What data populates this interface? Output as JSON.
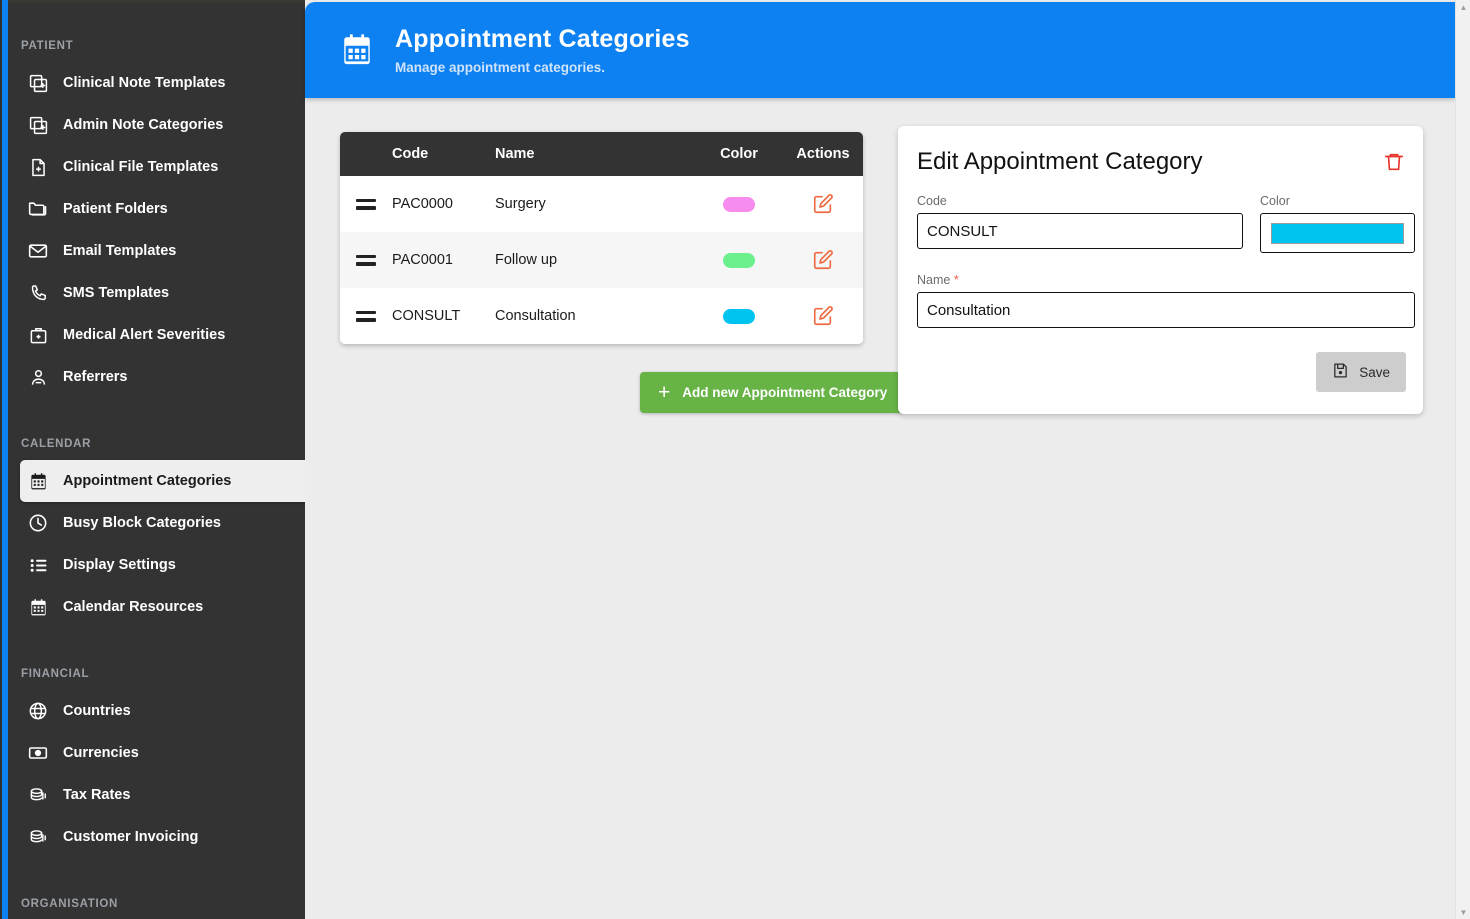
{
  "sidebar": {
    "groups": [
      {
        "label": "PATIENT",
        "items": [
          {
            "label": "Clinical Note Templates",
            "icon": "note-add-icon"
          },
          {
            "label": "Admin Note Categories",
            "icon": "note-add-icon"
          },
          {
            "label": "Clinical File Templates",
            "icon": "file-add-icon"
          },
          {
            "label": "Patient Folders",
            "icon": "folder-icon"
          },
          {
            "label": "Email Templates",
            "icon": "envelope-icon"
          },
          {
            "label": "SMS Templates",
            "icon": "phone-icon"
          },
          {
            "label": "Medical Alert Severities",
            "icon": "medical-kit-icon"
          },
          {
            "label": "Referrers",
            "icon": "person-icon"
          }
        ]
      },
      {
        "label": "CALENDAR",
        "items": [
          {
            "label": "Appointment Categories",
            "icon": "calendar-icon",
            "active": true
          },
          {
            "label": "Busy Block Categories",
            "icon": "clock-icon"
          },
          {
            "label": "Display Settings",
            "icon": "list-icon"
          },
          {
            "label": "Calendar Resources",
            "icon": "calendar-icon"
          }
        ]
      },
      {
        "label": "FINANCIAL",
        "items": [
          {
            "label": "Countries",
            "icon": "globe-icon"
          },
          {
            "label": "Currencies",
            "icon": "banknote-icon"
          },
          {
            "label": "Tax Rates",
            "icon": "coins-icon"
          },
          {
            "label": "Customer Invoicing",
            "icon": "coins-icon"
          }
        ]
      },
      {
        "label": "ORGANISATION",
        "items": []
      }
    ]
  },
  "header": {
    "icon": "calendar-icon",
    "title": "Appointment Categories",
    "subtitle": "Manage appointment categories.",
    "accent_color": "#0d80f2"
  },
  "table": {
    "columns": [
      "",
      "Code",
      "Name",
      "Color",
      "Actions"
    ],
    "rows": [
      {
        "handle": "drag-handle-icon",
        "code": "PAC0000",
        "name": "Surgery",
        "color": "#f78cee",
        "action": "edit-icon"
      },
      {
        "handle": "drag-handle-icon",
        "code": "PAC0001",
        "name": "Follow up",
        "color": "#6cf08d",
        "action": "edit-icon"
      },
      {
        "handle": "drag-handle-icon",
        "code": "CONSULT",
        "name": "Consultation",
        "color": "#00c4f0",
        "action": "edit-icon"
      }
    ]
  },
  "add_button": {
    "label": "Add new Appointment Category",
    "icon": "plus-icon",
    "color": "#67b346"
  },
  "edit_panel": {
    "title": "Edit Appointment Category",
    "delete_icon": "trash-icon",
    "code": {
      "label": "Code",
      "value": "CONSULT",
      "placeholder": ""
    },
    "color": {
      "label": "Color",
      "value": "#00c4f0"
    },
    "name": {
      "label": "Name",
      "required_marker": "*",
      "value": "Consultation",
      "placeholder": ""
    },
    "save": {
      "label": "Save",
      "icon": "save-disk-icon"
    }
  },
  "scrollbar": {
    "up": "▲",
    "down": "▼"
  }
}
